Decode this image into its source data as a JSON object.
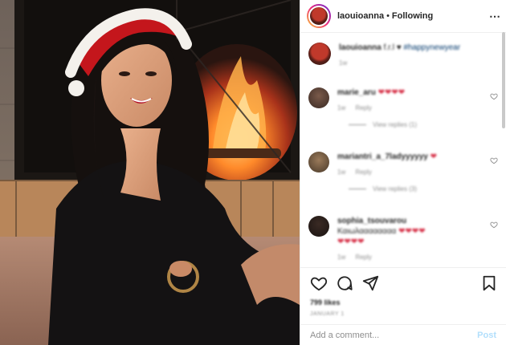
{
  "header": {
    "username": "laouioanna",
    "separator": "•",
    "following_label": "Following",
    "more_icon": "more-horizontal-icon"
  },
  "caption": {
    "username": "laouioanna",
    "text": "f.r.l",
    "hashtag": "#happynewyear",
    "time": "1w"
  },
  "comments": [
    {
      "username": "marie_aru",
      "text": "",
      "hearts": "❤❤❤❤",
      "time": "1w",
      "reply_label": "Reply",
      "view_replies": "View replies (1)"
    },
    {
      "username": "mariantri_a_7ladyyyyyy",
      "text": "",
      "hearts": "❤",
      "time": "1w",
      "reply_label": "Reply",
      "view_replies": "View replies (3)"
    },
    {
      "username": "sophia_tsouvarou",
      "text": "Καιωλαααααααα",
      "hearts": "❤❤❤❤",
      "hearts2": "❤❤❤❤",
      "time": "1w",
      "reply_label": "Reply"
    }
  ],
  "actions": {
    "like_icon": "heart-outline-icon",
    "comment_icon": "comment-bubble-icon",
    "share_icon": "paper-plane-icon",
    "save_icon": "bookmark-icon",
    "likes": "799 likes",
    "date": "JANUARY 1"
  },
  "composer": {
    "placeholder": "Add a comment...",
    "post_label": "Post"
  },
  "colors": {
    "link": "#00376b",
    "heart": "#d62f46",
    "post_disabled": "#b2dffc",
    "secondary_text": "#8e8e8e"
  }
}
